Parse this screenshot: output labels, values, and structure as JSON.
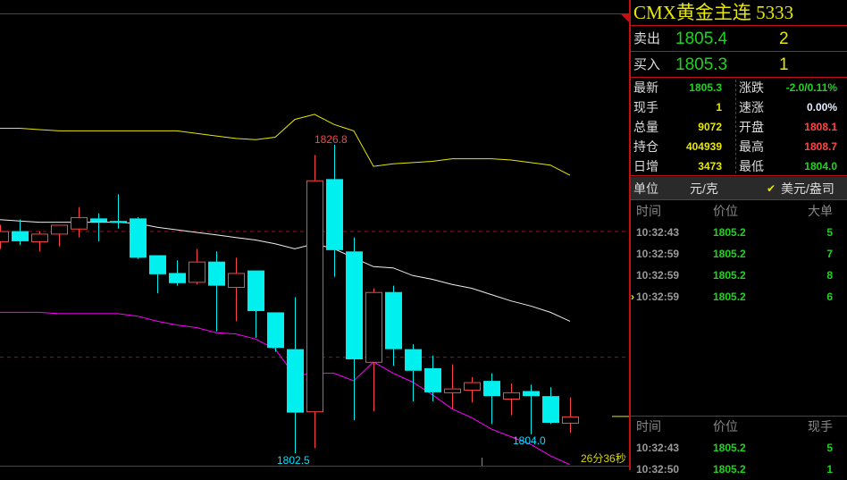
{
  "colors": {
    "up": "#ff4444",
    "down": "#00f0f0",
    "upper_band": "#e8e800",
    "mid_band": "#eeeeee",
    "lower_band": "#ff00ff",
    "grid": "#c41010",
    "accent": "#e8e800",
    "green": "#1ed41e"
  },
  "panel": {
    "title": "CMX黄金主连  5333",
    "sell": {
      "label": "卖出",
      "price": "1805.4",
      "volume": "2"
    },
    "buy": {
      "label": "买入",
      "price": "1805.3",
      "volume": "1"
    },
    "stats_left": [
      {
        "label": "最新",
        "value": "1805.3",
        "color": "#1ed41e"
      },
      {
        "label": "现手",
        "value": "1",
        "color": "#e8e800"
      },
      {
        "label": "总量",
        "value": "9072",
        "color": "#e8e800"
      },
      {
        "label": "持仓",
        "value": "404939",
        "color": "#e8e800"
      },
      {
        "label": "日增",
        "value": "3473",
        "color": "#e8e800"
      }
    ],
    "stats_right": [
      {
        "label": "涨跌",
        "value": "-2.0/0.11%",
        "color": "#1ed41e"
      },
      {
        "label": "速涨",
        "value": "0.00%",
        "color": "#e8eeff"
      },
      {
        "label": "开盘",
        "value": "1808.1",
        "color": "#ff4444"
      },
      {
        "label": "最高",
        "value": "1808.7",
        "color": "#ff4444"
      },
      {
        "label": "最低",
        "value": "1804.0",
        "color": "#1ed41e"
      }
    ],
    "unit": {
      "label": "单位",
      "option1": "元/克",
      "option2": "美元/盎司",
      "selected": "美元/盎司"
    },
    "big_orders": {
      "headers": [
        "时间",
        "价位",
        "大单"
      ],
      "rows": [
        [
          "10:32:43",
          "1805.2",
          "5"
        ],
        [
          "10:32:59",
          "1805.2",
          "7"
        ],
        [
          "10:32:59",
          "1805.2",
          "8"
        ],
        [
          "10:32:59",
          "1805.2",
          "6"
        ]
      ]
    },
    "ticks": {
      "headers": [
        "时间",
        "价位",
        "现手"
      ],
      "rows": [
        [
          "10:32:43",
          "1805.2",
          "5"
        ],
        [
          "10:32:50",
          "1805.2",
          "1"
        ]
      ]
    }
  },
  "chart": {
    "high_label": "1826.8",
    "low_label": "1802.5",
    "low2_label": "1804.0",
    "countdown": "26分36秒",
    "ref_lines": [
      1820.0,
      1810.1
    ],
    "last_price": 1805.4,
    "candles": [
      [
        1819.2,
        1820.0,
        1820.5,
        1818.6
      ],
      [
        1820.0,
        1819.2,
        1820.9,
        1818.9
      ],
      [
        1819.2,
        1819.8,
        1820.0,
        1818.4
      ],
      [
        1819.8,
        1820.5,
        1820.5,
        1818.8
      ],
      [
        1820.2,
        1821.1,
        1821.9,
        1819.5
      ],
      [
        1821.0,
        1820.7,
        1821.4,
        1819.2
      ],
      [
        1820.8,
        1820.7,
        1822.9,
        1820.2
      ],
      [
        1821.0,
        1817.9,
        1821.1,
        1817.8
      ],
      [
        1818.1,
        1816.6,
        1818.1,
        1815.1
      ],
      [
        1816.7,
        1815.9,
        1817.7,
        1815.7
      ],
      [
        1816.0,
        1817.6,
        1818.6,
        1815.8
      ],
      [
        1817.6,
        1815.7,
        1818.4,
        1812.1
      ],
      [
        1815.6,
        1816.7,
        1817.9,
        1812.9
      ],
      [
        1816.9,
        1813.7,
        1816.9,
        1811.6
      ],
      [
        1813.6,
        1810.8,
        1813.6,
        1810.5
      ],
      [
        1810.7,
        1805.7,
        1814.8,
        1802.5
      ],
      [
        1805.8,
        1824.0,
        1826.0,
        1802.9
      ],
      [
        1824.1,
        1818.5,
        1826.8,
        1816.4
      ],
      [
        1818.4,
        1809.9,
        1819.5,
        1805.1
      ],
      [
        1809.7,
        1815.2,
        1815.5,
        1805.8
      ],
      [
        1815.2,
        1810.7,
        1815.7,
        1809.4
      ],
      [
        1810.7,
        1809.0,
        1811.1,
        1806.6
      ],
      [
        1809.2,
        1807.3,
        1810.2,
        1806.6
      ],
      [
        1807.3,
        1807.6,
        1809.5,
        1806.0
      ],
      [
        1807.5,
        1808.1,
        1808.5,
        1806.5
      ],
      [
        1808.2,
        1807.0,
        1808.8,
        1804.8
      ],
      [
        1806.8,
        1807.3,
        1808.0,
        1805.5
      ],
      [
        1807.4,
        1807.0,
        1807.9,
        1804.0
      ],
      [
        1807.0,
        1804.9,
        1807.7,
        1804.8
      ],
      [
        1804.9,
        1805.4,
        1806.9,
        1804.1
      ]
    ],
    "upper": [
      1828.1,
      1828.1,
      1828.0,
      1827.9,
      1827.9,
      1827.9,
      1827.9,
      1827.9,
      1827.9,
      1827.9,
      1827.7,
      1827.5,
      1827.3,
      1827.2,
      1827.4,
      1828.8,
      1829.2,
      1828.4,
      1827.9,
      1825.1,
      1825.3,
      1825.4,
      1825.5,
      1825.7,
      1825.7,
      1825.7,
      1825.6,
      1825.4,
      1825.2,
      1824.4
    ],
    "middle": [
      1820.9,
      1820.8,
      1820.7,
      1820.7,
      1820.7,
      1820.7,
      1820.7,
      1820.6,
      1820.3,
      1820.1,
      1819.9,
      1819.7,
      1819.5,
      1819.3,
      1819.0,
      1818.6,
      1819.0,
      1818.6,
      1817.9,
      1817.2,
      1817.1,
      1816.5,
      1816.2,
      1815.8,
      1815.5,
      1815.0,
      1814.5,
      1814.1,
      1813.6,
      1812.9
    ],
    "lower": [
      1813.6,
      1813.6,
      1813.6,
      1813.5,
      1813.5,
      1813.5,
      1813.5,
      1813.3,
      1812.9,
      1812.6,
      1812.4,
      1812.0,
      1811.9,
      1811.5,
      1810.7,
      1808.6,
      1808.8,
      1808.8,
      1808.2,
      1809.7,
      1808.8,
      1808.1,
      1807.1,
      1806.0,
      1805.3,
      1804.4,
      1803.8,
      1803.2,
      1802.3,
      1801.6
    ]
  }
}
